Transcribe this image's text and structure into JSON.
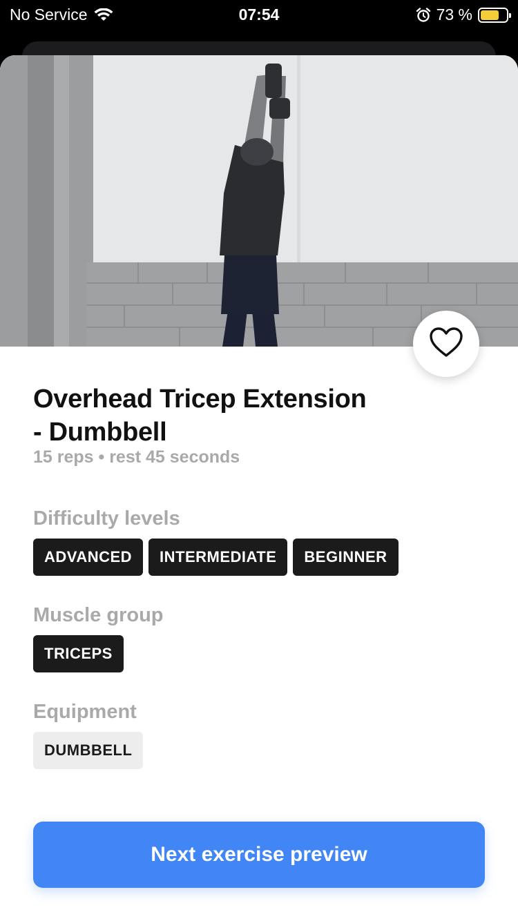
{
  "status_bar": {
    "carrier": "No Service",
    "time": "07:54",
    "battery_percent": "73 %",
    "battery_level": 0.73,
    "battery_color": "#f5cd3a",
    "icons": [
      "wifi-icon",
      "alarm-icon",
      "battery-icon"
    ]
  },
  "exercise": {
    "title_line1": "Overhead Tricep Extension",
    "title_line2": "- Dumbbell",
    "details": "15 reps • rest 45 seconds",
    "favorite_icon": "heart-outline-icon"
  },
  "difficulty": {
    "label": "Difficulty levels",
    "chips": [
      "ADVANCED",
      "INTERMEDIATE",
      "BEGINNER"
    ]
  },
  "muscle": {
    "label": "Muscle group",
    "chips": [
      "TRICEPS"
    ]
  },
  "equipment": {
    "label": "Equipment",
    "chips": [
      "DUMBBELL"
    ]
  },
  "next_button": {
    "label": "Next exercise preview",
    "color": "#4285f4"
  }
}
